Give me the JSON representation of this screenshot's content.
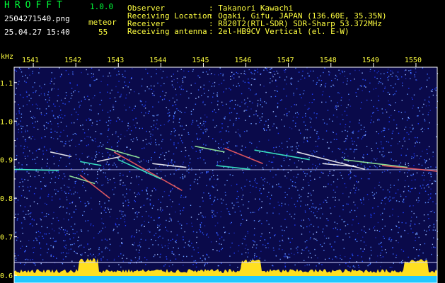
{
  "header": {
    "app_name": "HROFFT",
    "version": "1.0.0",
    "filename": "2504271540.png",
    "datetime": "25.04.27 15:40",
    "meteor_label": "meteor",
    "meteor_count": "55",
    "info_labels": [
      "Observer",
      "Receiving Location",
      "Receiver",
      "Receiving antenna"
    ],
    "info_values": [
      ": Takanori Kawachi",
      ": Ogaki, Gifu, JAPAN (136.60E, 35.35N)",
      ": R820T2(RTL-SDR) SDR-Sharp 53.372MHz",
      ": 2el-HB9CV Vertical (el. E-W)"
    ]
  },
  "chart_data": {
    "type": "heatmap",
    "ylabel": "kHz",
    "x_ticks": [
      "1541",
      "1542",
      "1543",
      "1544",
      "1545",
      "1546",
      "1547",
      "1548",
      "1549",
      "1550"
    ],
    "y_ticks": [
      "1.1",
      "1.0",
      "0.9",
      "0.8",
      "0.7",
      "0.6"
    ],
    "ylim": [
      0.58,
      1.14
    ],
    "xlim": [
      1540.55,
      1550.5
    ],
    "colors": {
      "background": "#0a0a4a",
      "noise": "#1e3cff",
      "trace_hot": "#ff6060",
      "trace_mid": "#40ffd0",
      "border": "#ffffff",
      "baseline": "#ffe020",
      "cyan_floor": "#20c8ff"
    },
    "carrier_frequency_khz": 0.874,
    "meteor_echoes": [
      {
        "x": [
          1540.55,
          1541.6
        ],
        "y": [
          0.875,
          0.872
        ]
      },
      {
        "x": [
          1541.4,
          1541.9
        ],
        "y": [
          0.92,
          0.908
        ]
      },
      {
        "x": [
          1541.85,
          1542.45
        ],
        "y": [
          0.858,
          0.838
        ]
      },
      {
        "x": [
          1542.1,
          1542.8
        ],
        "y": [
          0.86,
          0.8
        ]
      },
      {
        "x": [
          1542.1,
          1542.6
        ],
        "y": [
          0.895,
          0.885
        ]
      },
      {
        "x": [
          1542.5,
          1543.05
        ],
        "y": [
          0.895,
          0.908
        ]
      },
      {
        "x": [
          1542.7,
          1543.5
        ],
        "y": [
          0.93,
          0.905
        ]
      },
      {
        "x": [
          1542.9,
          1544.5
        ],
        "y": [
          0.92,
          0.82
        ]
      },
      {
        "x": [
          1543.0,
          1544.0
        ],
        "y": [
          0.9,
          0.85
        ]
      },
      {
        "x": [
          1543.8,
          1544.6
        ],
        "y": [
          0.89,
          0.88
        ]
      },
      {
        "x": [
          1544.8,
          1545.5
        ],
        "y": [
          0.935,
          0.92
        ]
      },
      {
        "x": [
          1545.5,
          1546.4
        ],
        "y": [
          0.93,
          0.89
        ]
      },
      {
        "x": [
          1546.2,
          1547.5
        ],
        "y": [
          0.925,
          0.9
        ]
      },
      {
        "x": [
          1547.2,
          1548.8
        ],
        "y": [
          0.92,
          0.875
        ]
      },
      {
        "x": [
          1548.3,
          1549.8
        ],
        "y": [
          0.9,
          0.88
        ]
      },
      {
        "x": [
          1549.2,
          1550.5
        ],
        "y": [
          0.885,
          0.87
        ]
      },
      {
        "x": [
          1545.3,
          1546.1
        ],
        "y": [
          0.885,
          0.875
        ]
      },
      {
        "x": [
          1547.8,
          1548.6
        ],
        "y": [
          0.89,
          0.882
        ]
      }
    ]
  }
}
